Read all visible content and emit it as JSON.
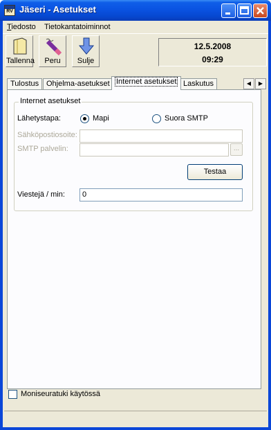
{
  "window": {
    "title": "Jäseri - Asetukset"
  },
  "menu": {
    "file_prefix": "T",
    "file_rest": "iedosto",
    "db": "Tietokantatoiminnot"
  },
  "toolbar": {
    "save": "Tallenna",
    "cancel": "Peru",
    "close": "Sulje"
  },
  "clock": {
    "date": "12.5.2008",
    "time": "09:29"
  },
  "tabs": [
    "Tulostus",
    "Ohjelma-asetukset",
    "Internet asetukset",
    "Laskutus"
  ],
  "internet": {
    "group_title": "Internet asetukset",
    "send_method_label": "Lähetystapa:",
    "opt_mapi": "Mapi",
    "opt_smtp": "Suora SMTP",
    "selected": "Mapi",
    "email_label": "Sähköpostiosoite:",
    "email_value": "",
    "smtp_label": "SMTP palvelin:",
    "smtp_value": "",
    "browse": "...",
    "test_button": "Testaa",
    "rate_label": "Viestejä / min:",
    "rate_value": "0"
  },
  "multiclub": {
    "label": "Moniseuratuki käytössä",
    "checked": false
  }
}
